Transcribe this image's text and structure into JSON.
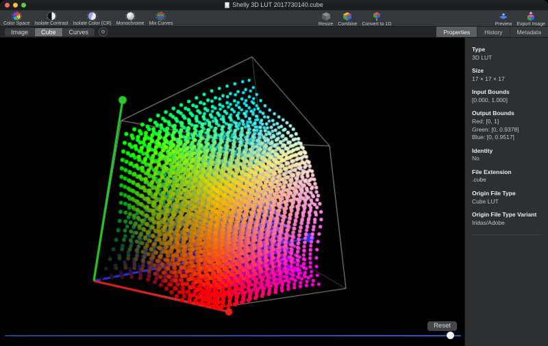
{
  "window": {
    "title": "Shelly 3D LUT 2017730140.cube"
  },
  "toolbar": {
    "items": [
      {
        "id": "color-space",
        "label": "Color Space"
      },
      {
        "id": "isolate-contrast",
        "label": "Isolate Contrast"
      },
      {
        "id": "isolate-color",
        "label": "Isolate Color (CR)"
      },
      {
        "id": "monochrome",
        "label": "Monochrome"
      },
      {
        "id": "mix-curves",
        "label": "Mix Curves"
      },
      {
        "id": "resize",
        "label": "Resize"
      },
      {
        "id": "combine",
        "label": "Combine"
      },
      {
        "id": "convert-to-1d",
        "label": "Convert to 1D"
      },
      {
        "id": "preview",
        "label": "Preview"
      },
      {
        "id": "export-image",
        "label": "Export Image"
      }
    ]
  },
  "tabs": {
    "left": [
      {
        "label": "Image"
      },
      {
        "label": "Cube"
      },
      {
        "label": "Curves"
      }
    ],
    "left_active": "Cube",
    "right": [
      {
        "label": "Properties"
      },
      {
        "label": "History"
      },
      {
        "label": "Metadata"
      }
    ],
    "right_active": "Properties"
  },
  "viewer": {
    "reset_label": "Reset",
    "slider_value": 0.985
  },
  "sidebar": {
    "fields": [
      {
        "label": "Type",
        "value": "3D LUT"
      },
      {
        "label": "Size",
        "value": "17 × 17 × 17"
      },
      {
        "label": "Input Bounds",
        "value": "[0.000, 1.000]"
      },
      {
        "label": "Output Bounds",
        "value": "Red: [0, 1]\nGreen: [0, 0.9378]\nBlue: [0, 0.9517]"
      },
      {
        "label": "Identity",
        "value": "No"
      },
      {
        "label": "File Extension",
        "value": ".cube"
      },
      {
        "label": "Origin File Type",
        "value": "Cube LUT"
      },
      {
        "label": "Origin File Type Variant",
        "value": "Iridas/Adobe"
      }
    ]
  },
  "cube_view": {
    "lut_size": 17,
    "background": "#000000",
    "wire_color": "rgba(165,165,165,0.9)",
    "wire_hidden_color": "#4a4a4a",
    "corners": {
      "c000": [
        137,
        355
      ],
      "c100": [
        318,
        394
      ],
      "c010": [
        177,
        121
      ],
      "c110": [
        352,
        153
      ],
      "c001": [
        400,
        305
      ],
      "c101": [
        505,
        366
      ],
      "c011": [
        368,
        28
      ],
      "c111": [
        481,
        158
      ]
    },
    "axes": {
      "red": {
        "color": "#e32322",
        "end": [
          334,
          400
        ],
        "ball_r": 5.5
      },
      "green": {
        "color": "#2acb2a",
        "end": [
          179,
          91
        ],
        "ball_r": 6
      },
      "blue": {
        "color": "#2437e8",
        "end": [
          452,
          292
        ],
        "ball_r": 7
      }
    },
    "output_max": {
      "r": 1.0,
      "g": 0.9378,
      "b": 0.9517
    }
  }
}
